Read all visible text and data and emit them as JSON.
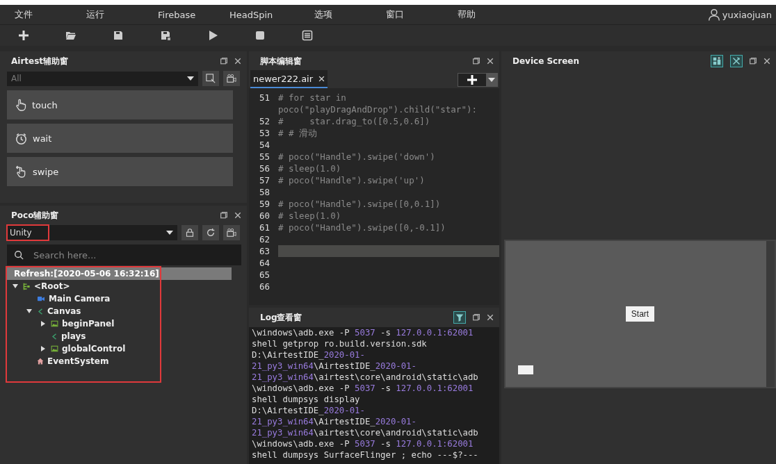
{
  "menu": [
    "文件",
    "运行",
    "Firebase",
    "HeadSpin",
    "选项",
    "窗口",
    "帮助"
  ],
  "user": {
    "name": "yuxiaojuan"
  },
  "toolbar": [
    {
      "kind": "new"
    },
    {
      "kind": "open"
    },
    {
      "kind": "save"
    },
    {
      "kind": "save-as"
    },
    {
      "kind": "run"
    },
    {
      "kind": "stop"
    },
    {
      "kind": "log"
    }
  ],
  "airtest_panel": {
    "title": "Airtest辅助窗",
    "filter": {
      "placeholder": "All"
    },
    "actions": [
      {
        "label": "touch",
        "kind": "touch"
      },
      {
        "label": "wait",
        "kind": "wait"
      },
      {
        "label": "swipe",
        "kind": "swipe"
      }
    ]
  },
  "poco_panel": {
    "title": "Poco辅助窗",
    "mode": {
      "value": "Unity",
      "highlighted": true
    },
    "search": {
      "placeholder": "Search here..."
    },
    "refresh": "Refresh:[2020-05-06 16:32:16]",
    "tree_highlighted": true,
    "tree": [
      {
        "label": "<Root>",
        "kind": "root",
        "expanded": true,
        "children": [
          {
            "label": "Main Camera",
            "kind": "camera"
          },
          {
            "label": "Canvas",
            "kind": "canvas",
            "expanded": true,
            "children": [
              {
                "label": "beginPanel",
                "kind": "image",
                "expanded": false
              },
              {
                "label": "plays",
                "kind": "canvas"
              },
              {
                "label": "globalControl",
                "kind": "image",
                "expanded": false
              }
            ]
          },
          {
            "label": "EventSystem",
            "kind": "home"
          }
        ]
      }
    ]
  },
  "editor": {
    "title": "脚本编辑窗",
    "tabs": [
      {
        "label": "newer222.air",
        "selected": true
      }
    ],
    "lines": [
      {
        "number": "51",
        "text": [
          "# for star in",
          "poco(\"playDragAndDrop\").child(\"star\"):"
        ],
        "current": false
      },
      {
        "number": "52",
        "text": [
          "#     star.drag_to([0.5,0.6])"
        ],
        "current": false
      },
      {
        "number": "53",
        "text": [
          "# # 滑动"
        ],
        "current": false
      },
      {
        "number": "54",
        "current": false
      },
      {
        "number": "55",
        "text": [
          "# poco(\"Handle\").swipe('down')"
        ],
        "current": false
      },
      {
        "number": "56",
        "text": [
          "# sleep(1.0)"
        ],
        "current": false
      },
      {
        "number": "57",
        "text": [
          "# poco(\"Handle\").swipe('up')"
        ],
        "current": false
      },
      {
        "number": "58",
        "current": false
      },
      {
        "number": "59",
        "text": [
          "# poco(\"Handle\").swipe([0,0.1])"
        ],
        "current": false
      },
      {
        "number": "60",
        "text": [
          "# sleep(1.0)"
        ],
        "current": false
      },
      {
        "number": "61",
        "text": [
          "# poco(\"Handle\").swipe([0,-0.1])"
        ],
        "current": false
      },
      {
        "number": "62",
        "current": false
      },
      {
        "number": "63",
        "current": true
      },
      {
        "number": "64",
        "current": false
      },
      {
        "number": "65",
        "current": false
      },
      {
        "number": "66",
        "current": false
      }
    ]
  },
  "log": {
    "title": "Log查看窗",
    "lines": [
      [
        {
          "text": "\\windows\\adb.exe -P ",
          "kind": "plain"
        },
        {
          "text": "5037",
          "kind": "number"
        },
        {
          "text": " -s ",
          "kind": "plain"
        },
        {
          "text": "127.0.0.1:62001",
          "kind": "number"
        }
      ],
      [
        {
          "text": "shell getprop ro.build.version.sdk",
          "kind": "plain"
        }
      ],
      [
        {
          "text": "D:\\AirtestIDE_",
          "kind": "plain"
        },
        {
          "text": "2020-01-",
          "kind": "number"
        }
      ],
      [
        {
          "text": "21_py3_win64",
          "kind": "number"
        },
        {
          "text": "\\AirtestIDE_",
          "kind": "plain"
        },
        {
          "text": "2020-01-",
          "kind": "number"
        }
      ],
      [
        {
          "text": "21_py3_win64",
          "kind": "number"
        },
        {
          "text": "\\airtest\\core\\android\\static\\adb",
          "kind": "plain"
        }
      ],
      [
        {
          "text": "\\windows\\adb.exe -P ",
          "kind": "plain"
        },
        {
          "text": "5037",
          "kind": "number"
        },
        {
          "text": " -s ",
          "kind": "plain"
        },
        {
          "text": "127.0.0.1:62001",
          "kind": "number"
        }
      ],
      [
        {
          "text": "shell dumpsys display",
          "kind": "plain"
        }
      ],
      [
        {
          "text": "D:\\AirtestIDE_",
          "kind": "plain"
        },
        {
          "text": "2020-01-",
          "kind": "number"
        }
      ],
      [
        {
          "text": "21_py3_win64",
          "kind": "number"
        },
        {
          "text": "\\AirtestIDE_",
          "kind": "plain"
        },
        {
          "text": "2020-01-",
          "kind": "number"
        }
      ],
      [
        {
          "text": "21_py3_win64",
          "kind": "number"
        },
        {
          "text": "\\airtest\\core\\android\\static\\adb",
          "kind": "plain"
        }
      ],
      [
        {
          "text": "\\windows\\adb.exe -P ",
          "kind": "plain"
        },
        {
          "text": "5037",
          "kind": "number"
        },
        {
          "text": " -s ",
          "kind": "plain"
        },
        {
          "text": "127.0.0.1:62001",
          "kind": "number"
        }
      ],
      [
        {
          "text": "shell dumpsys SurfaceFlinger ; echo ---$?---",
          "kind": "plain"
        }
      ]
    ]
  },
  "device": {
    "title": "Device Screen",
    "start_button": "Start"
  }
}
